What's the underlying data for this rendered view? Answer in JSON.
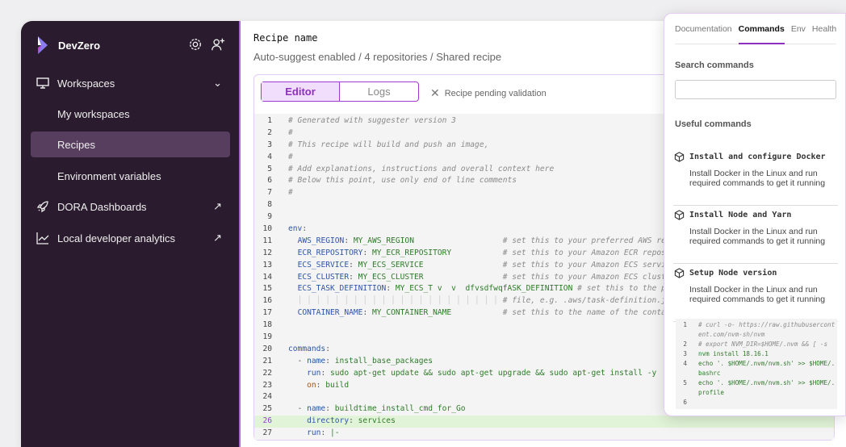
{
  "sidebar": {
    "brand": "DevZero",
    "items": [
      {
        "label": "Workspaces",
        "icon": "monitor-icon"
      },
      {
        "label": "My workspaces"
      },
      {
        "label": "Recipes",
        "selected": true
      },
      {
        "label": "Environment variables"
      },
      {
        "label": "DORA Dashboards",
        "icon": "rocket-icon",
        "external": "↗"
      },
      {
        "label": "Local developer analytics",
        "icon": "chart-line-icon",
        "external": "↗"
      }
    ],
    "colors": {
      "bg": "#2a1c2e",
      "selected": "#573d5e",
      "accent": "#a66bd6"
    }
  },
  "main": {
    "title": "Recipe name",
    "subtitle": "Auto-suggest enabled / 4 repositories / Shared recipe",
    "tabs": {
      "editor": "Editor",
      "logs": "Logs"
    },
    "status": "Recipe pending validation",
    "highlight_line": 26,
    "code": [
      [
        [
          "c",
          "# Generated with suggester version 3"
        ]
      ],
      [
        [
          "c",
          "#"
        ]
      ],
      [
        [
          "c",
          "# This recipe will build and push an image,"
        ]
      ],
      [
        [
          "c",
          "#"
        ]
      ],
      [
        [
          "c",
          "# Add explanations, instructions and overall context here"
        ]
      ],
      [
        [
          "c",
          "# Below this point, use only end of line comments"
        ]
      ],
      [
        [
          "c",
          "#"
        ]
      ],
      [],
      [],
      [
        [
          "k",
          "env"
        ],
        [
          "p",
          ":"
        ]
      ],
      [
        [
          "p",
          "  "
        ],
        [
          "k",
          "AWS_REGION"
        ],
        [
          "p",
          ": "
        ],
        [
          "v",
          "MY_AWS_REGION"
        ],
        [
          "p",
          "                   "
        ],
        [
          "c",
          "# set this to your preferred AWS region"
        ]
      ],
      [
        [
          "p",
          "  "
        ],
        [
          "k",
          "ECR_REPOSITORY"
        ],
        [
          "p",
          ": "
        ],
        [
          "v",
          "MY_ECR_REPOSITORY"
        ],
        [
          "p",
          "           "
        ],
        [
          "c",
          "# set this to your Amazon ECR repository name"
        ]
      ],
      [
        [
          "p",
          "  "
        ],
        [
          "k",
          "ECS_SERVICE"
        ],
        [
          "p",
          ": "
        ],
        [
          "v",
          "MY_ECS_SERVICE"
        ],
        [
          "p",
          "                 "
        ],
        [
          "c",
          "# set this to your Amazon ECS service name"
        ]
      ],
      [
        [
          "p",
          "  "
        ],
        [
          "k",
          "ECS_CLUSTER"
        ],
        [
          "p",
          ": "
        ],
        [
          "v",
          "MY_ECS_CLUSTER"
        ],
        [
          "p",
          "                 "
        ],
        [
          "c",
          "# set this to your Amazon ECS cluster name"
        ]
      ],
      [
        [
          "p",
          "  "
        ],
        [
          "k",
          "ECS_TASK_DEFINITION"
        ],
        [
          "p",
          ": "
        ],
        [
          "v",
          "MY_ECS_T v  v  dfvsdfwqfASK_DEFINITION"
        ],
        [
          "p",
          " "
        ],
        [
          "c",
          "# set this to the path to your Amazon ECS task definition"
        ]
      ],
      [
        [
          "p",
          "  "
        ],
        [
          "g",
          "│ │ │ │ │ │ │ │ │ │ │ │ │ │ │ │ │ │ │ │ │ │"
        ],
        [
          "p",
          " "
        ],
        [
          "c",
          "# file, e.g. .aws/task-definition.json"
        ]
      ],
      [
        [
          "p",
          "  "
        ],
        [
          "k",
          "CONTAINER_NAME"
        ],
        [
          "p",
          ": "
        ],
        [
          "v",
          "MY_CONTAINER_NAME"
        ],
        [
          "p",
          "           "
        ],
        [
          "c",
          "# set this to the name of the container"
        ]
      ],
      [],
      [],
      [
        [
          "k",
          "commands"
        ],
        [
          "p",
          ":"
        ]
      ],
      [
        [
          "p",
          "  - "
        ],
        [
          "k",
          "name"
        ],
        [
          "p",
          ": "
        ],
        [
          "v",
          "install_base_packages"
        ]
      ],
      [
        [
          "p",
          "    "
        ],
        [
          "k",
          "run"
        ],
        [
          "p",
          ": "
        ],
        [
          "v",
          "sudo apt-get update && sudo apt-get upgrade && sudo apt-get install -y"
        ]
      ],
      [
        [
          "p",
          "    "
        ],
        [
          "o",
          "on"
        ],
        [
          "p",
          ": "
        ],
        [
          "v",
          "build"
        ]
      ],
      [],
      [
        [
          "p",
          "  - "
        ],
        [
          "k",
          "name"
        ],
        [
          "p",
          ": "
        ],
        [
          "v",
          "buildtime_install_cmd_for_Go"
        ]
      ],
      [
        [
          "p",
          "    "
        ],
        [
          "k",
          "directory"
        ],
        [
          "p",
          ": "
        ],
        [
          "v",
          "services"
        ]
      ],
      [
        [
          "p",
          "    "
        ],
        [
          "k",
          "run"
        ],
        [
          "p",
          ": "
        ],
        [
          "v",
          "|-"
        ]
      ]
    ]
  },
  "panel": {
    "tabs": [
      "Documentation",
      "Commands",
      "Env",
      "Health"
    ],
    "active_tab": "Commands",
    "search_label": "Search commands",
    "search_value": "",
    "useful_label": "Useful commands",
    "commands": [
      {
        "title": "Install and configure Docker",
        "desc": "Install Docker in the Linux and run required commands to get it running"
      },
      {
        "title": "Install Node and Yarn",
        "desc": "Install Docker in the Linux and run required commands to get it running"
      },
      {
        "title": "Setup Node version",
        "desc": "Install Docker in the Linux and run required commands to get it running"
      }
    ],
    "snippet": [
      [
        [
          "c",
          "# curl -o- https://raw.githubusercontent.com/nvm-sh/nvm"
        ]
      ],
      [
        [
          "c",
          "# export NVM_DIR=$HOME/.nvm && [ -s"
        ]
      ],
      [
        [
          "v",
          "nvm install 18.16.1"
        ]
      ],
      [
        [
          "v",
          "echo '. $HOME/.nvm/nvm.sh' >> $HOME/.bashrc"
        ]
      ],
      [
        [
          "v",
          "echo '. $HOME/.nvm/nvm.sh' >> $HOME/.profile"
        ]
      ],
      []
    ]
  }
}
